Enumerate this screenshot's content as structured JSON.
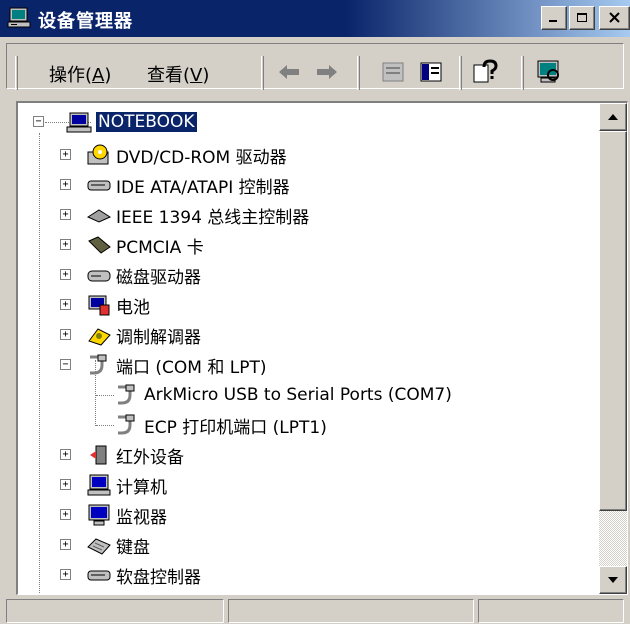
{
  "window": {
    "title": "设备管理器"
  },
  "menu": [
    {
      "label": "操作(",
      "accel": "A",
      "suffix": ")"
    },
    {
      "label": "查看(",
      "accel": "V",
      "suffix": ")"
    }
  ],
  "toolbar": {
    "icons": [
      "back-arrow",
      "forward-arrow",
      "properties",
      "toggle-view",
      "help",
      "scan-hardware"
    ]
  },
  "tree": {
    "root": "NOTEBOOK",
    "items": [
      {
        "label": "DVD/CD-ROM 驱动器",
        "icon": "dvd-drive-icon",
        "state": "collapsed"
      },
      {
        "label": "IDE ATA/ATAPI 控制器",
        "icon": "ide-controller-icon",
        "state": "collapsed"
      },
      {
        "label": "IEEE 1394 总线主控制器",
        "icon": "ieee1394-icon",
        "state": "collapsed"
      },
      {
        "label": "PCMCIA 卡",
        "icon": "pcmcia-icon",
        "state": "collapsed"
      },
      {
        "label": "磁盘驱动器",
        "icon": "disk-drive-icon",
        "state": "collapsed"
      },
      {
        "label": "电池",
        "icon": "battery-icon",
        "state": "collapsed"
      },
      {
        "label": "调制解调器",
        "icon": "modem-icon",
        "state": "collapsed"
      },
      {
        "label": "端口 (COM 和 LPT)",
        "icon": "port-icon",
        "state": "expanded",
        "children": [
          {
            "label": "ArkMicro USB to Serial Ports (COM7)",
            "icon": "port-icon"
          },
          {
            "label": "ECP 打印机端口 (LPT1)",
            "icon": "port-icon"
          }
        ]
      },
      {
        "label": "红外设备",
        "icon": "infrared-icon",
        "state": "collapsed"
      },
      {
        "label": "计算机",
        "icon": "computer-icon",
        "state": "collapsed"
      },
      {
        "label": "监视器",
        "icon": "monitor-icon",
        "state": "collapsed"
      },
      {
        "label": "键盘",
        "icon": "keyboard-icon",
        "state": "collapsed"
      },
      {
        "label": "软盘控制器",
        "icon": "floppy-controller-icon",
        "state": "collapsed"
      }
    ]
  },
  "colors": {
    "title_bar": "#0a246a",
    "face": "#d4d0c8",
    "selection": "#0a246a"
  }
}
